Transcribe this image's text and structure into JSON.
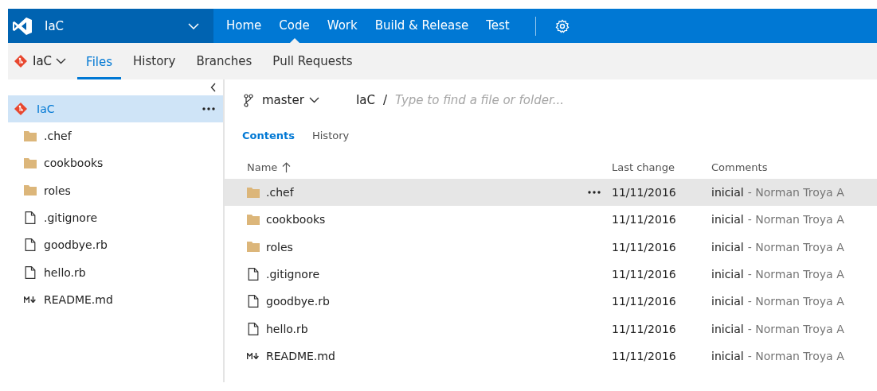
{
  "header": {
    "project": "IaC",
    "nav": [
      {
        "label": "Home",
        "selected": false
      },
      {
        "label": "Code",
        "selected": true
      },
      {
        "label": "Work",
        "selected": false
      },
      {
        "label": "Build & Release",
        "selected": false
      },
      {
        "label": "Test",
        "selected": false
      }
    ]
  },
  "repo_bar": {
    "repo": "IaC",
    "tabs": [
      {
        "label": "Files",
        "selected": true
      },
      {
        "label": "History",
        "selected": false
      },
      {
        "label": "Branches",
        "selected": false
      },
      {
        "label": "Pull Requests",
        "selected": false
      }
    ]
  },
  "sidebar": {
    "tree": {
      "label": "IaC",
      "kind": "repo",
      "selected": true,
      "children": [
        {
          "label": ".chef",
          "kind": "folder"
        },
        {
          "label": "cookbooks",
          "kind": "folder"
        },
        {
          "label": "roles",
          "kind": "folder"
        },
        {
          "label": ".gitignore",
          "kind": "file"
        },
        {
          "label": "goodbye.rb",
          "kind": "file"
        },
        {
          "label": "hello.rb",
          "kind": "file"
        },
        {
          "label": "README.md",
          "kind": "markdown"
        }
      ]
    }
  },
  "main": {
    "branch": "master",
    "path": "IaC",
    "separator": "/",
    "search": {
      "placeholder": "Type to find a file or folder..."
    },
    "tabs": [
      {
        "label": "Contents",
        "selected": true
      },
      {
        "label": "History",
        "selected": false
      }
    ],
    "table": {
      "columns": [
        {
          "label": "Name",
          "sorted": true
        },
        {
          "label": "Last change",
          "sorted": false
        },
        {
          "label": "Comments",
          "sorted": false
        }
      ],
      "rows": [
        {
          "kind": "folder",
          "name": ".chef",
          "last_change": "11/11/2016",
          "comment": "inicial",
          "author": "- Norman Troya A",
          "selected": true
        },
        {
          "kind": "folder",
          "name": "cookbooks",
          "last_change": "11/11/2016",
          "comment": "inicial",
          "author": "- Norman Troya A",
          "selected": false
        },
        {
          "kind": "folder",
          "name": "roles",
          "last_change": "11/11/2016",
          "comment": "inicial",
          "author": "- Norman Troya A",
          "selected": false
        },
        {
          "kind": "file",
          "name": ".gitignore",
          "last_change": "11/11/2016",
          "comment": "inicial",
          "author": "- Norman Troya A",
          "selected": false
        },
        {
          "kind": "file",
          "name": "goodbye.rb",
          "last_change": "11/11/2016",
          "comment": "inicial",
          "author": "- Norman Troya A",
          "selected": false
        },
        {
          "kind": "file",
          "name": "hello.rb",
          "last_change": "11/11/2016",
          "comment": "inicial",
          "author": "- Norman Troya A",
          "selected": false
        },
        {
          "kind": "markdown",
          "name": "README.md",
          "last_change": "11/11/2016",
          "comment": "inicial",
          "author": "- Norman Troya A",
          "selected": false
        }
      ]
    }
  }
}
